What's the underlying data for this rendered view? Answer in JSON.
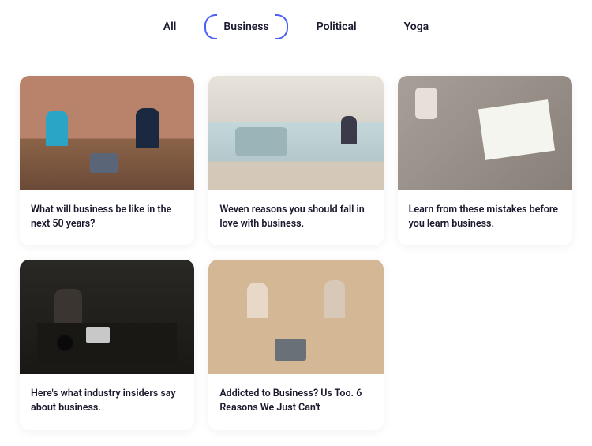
{
  "tabs": [
    {
      "label": "All",
      "active": false
    },
    {
      "label": "Business",
      "active": true
    },
    {
      "label": "Political",
      "active": false
    },
    {
      "label": "Yoga",
      "active": false
    }
  ],
  "cards": [
    {
      "title": "What will business be like in the next 50 years?"
    },
    {
      "title": "Weven reasons you should fall in love with business."
    },
    {
      "title": "Learn from these mistakes before you learn business."
    },
    {
      "title": "Here's what industry insiders say about business."
    },
    {
      "title": "Addicted to Business? Us Too. 6 Reasons We Just Can't"
    }
  ]
}
